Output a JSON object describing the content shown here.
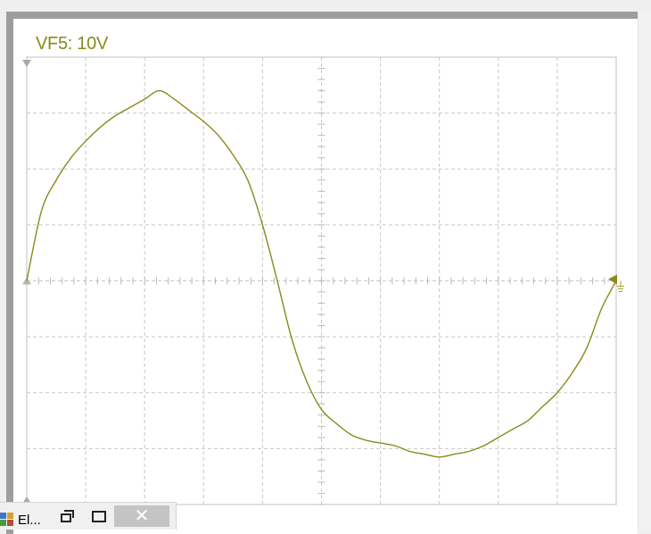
{
  "channel": {
    "label": "VF5: 10V"
  },
  "colors": {
    "trace": "#8a8a1c",
    "grid": "#c8c8c8",
    "frame_border": "#9d9d9d",
    "axis_tick": "#b8b8b8"
  },
  "chart_data": {
    "type": "line",
    "title": "VF5: 10V",
    "xlabel": "",
    "ylabel": "",
    "divisions": {
      "x": 10,
      "y": 8
    },
    "xlim": [
      0,
      10
    ],
    "ylim": [
      -4,
      4
    ],
    "grid": true,
    "series": [
      {
        "x": [
          0,
          0.25,
          0.5,
          0.75,
          1,
          1.25,
          1.5,
          1.75,
          2,
          2.25,
          2.5,
          2.75,
          3,
          3.25,
          3.5,
          3.75,
          4,
          4.25,
          4.5,
          4.75,
          5,
          5.25,
          5.5,
          5.75,
          6,
          6.25,
          6.5,
          6.75,
          7,
          7.25,
          7.5,
          7.75,
          8,
          8.25,
          8.5,
          8.75,
          9,
          9.25,
          9.5,
          9.75,
          10
        ],
        "y": [
          0,
          1.25,
          1.8,
          2.2,
          2.5,
          2.75,
          2.95,
          3.1,
          3.25,
          3.4,
          3.25,
          3.05,
          2.85,
          2.6,
          2.25,
          1.8,
          1.0,
          0,
          -1.05,
          -1.8,
          -2.3,
          -2.55,
          -2.75,
          -2.85,
          -2.9,
          -2.95,
          -3.05,
          -3.1,
          -3.15,
          -3.1,
          -3.05,
          -2.95,
          -2.8,
          -2.65,
          -2.5,
          -2.25,
          -2.0,
          -1.65,
          -1.2,
          -0.5,
          0
        ]
      }
    ]
  },
  "taskbar": {
    "app_title": "El...",
    "app_icon": "app-icon",
    "restore_icon": "restore-icon",
    "maximize_icon": "maximize-icon",
    "close_icon": "close-icon",
    "close_glyph": "✕"
  }
}
